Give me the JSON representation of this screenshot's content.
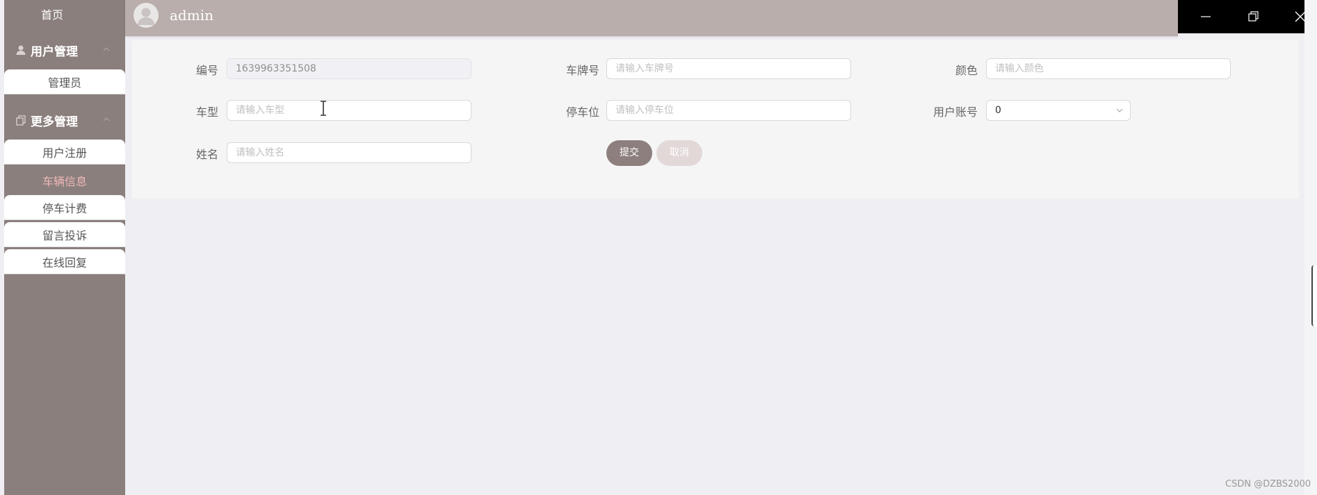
{
  "sidebar": {
    "home": "首页",
    "groups": [
      {
        "label": "用户管理",
        "icon": "user-icon"
      },
      {
        "label": "更多管理",
        "icon": "copy-icon"
      }
    ],
    "user_items": [
      "管理员"
    ],
    "more_items": [
      "用户注册",
      "车辆信息",
      "停车计费",
      "留言投诉",
      "在线回复"
    ],
    "active_item": "车辆信息"
  },
  "header": {
    "username": "admin"
  },
  "form": {
    "fields": [
      {
        "label": "编号",
        "value": "1639963351508",
        "placeholder": "",
        "disabled": true
      },
      {
        "label": "车牌号",
        "value": "",
        "placeholder": "请输入车牌号"
      },
      {
        "label": "颜色",
        "value": "",
        "placeholder": "请输入颜色"
      },
      {
        "label": "车型",
        "value": "",
        "placeholder": "请输入车型"
      },
      {
        "label": "停车位",
        "value": "",
        "placeholder": "请输入停车位"
      },
      {
        "label": "用户账号",
        "value": "0",
        "placeholder": "",
        "type": "select"
      },
      {
        "label": "姓名",
        "value": "",
        "placeholder": "请输入姓名"
      }
    ],
    "submit_label": "提交",
    "cancel_label": "取消"
  },
  "watermark": "CSDN @DZBS2000",
  "colors": {
    "sidebar": "#8a7f7d",
    "header": "#b9aeab",
    "active": "#f0b8b8",
    "submit": "#8d7f7d",
    "cancel": "#e3d8d8"
  }
}
